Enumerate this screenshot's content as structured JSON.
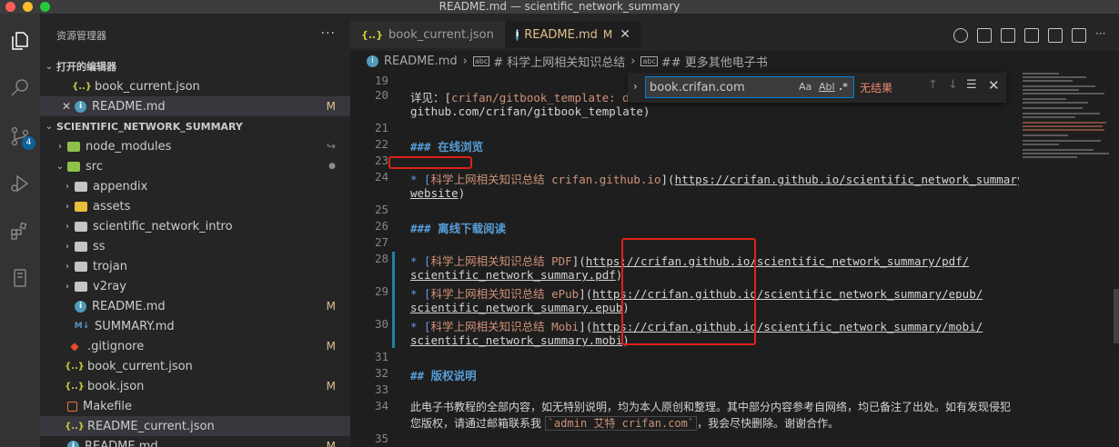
{
  "window": {
    "title": "README.md — scientific_network_summary"
  },
  "activity_bar": {
    "scm_badge": "4"
  },
  "sidebar": {
    "header": "资源管理器",
    "more": "···",
    "open_editors_title": "打开的编辑器",
    "open_editors": [
      {
        "name": "book_current.json",
        "icon": "{..}",
        "decoration": ""
      },
      {
        "name": "README.md",
        "icon": "i",
        "decoration": "M"
      }
    ],
    "project_title": "SCIENTIFIC_NETWORK_SUMMARY",
    "tree": [
      {
        "name": "node_modules",
        "decoration": "↪"
      },
      {
        "name": "src",
        "decoration": "●"
      },
      {
        "name": "appendix",
        "decoration": ""
      },
      {
        "name": "assets",
        "decoration": ""
      },
      {
        "name": "scientific_network_intro",
        "decoration": ""
      },
      {
        "name": "ss",
        "decoration": ""
      },
      {
        "name": "trojan",
        "decoration": ""
      },
      {
        "name": "v2ray",
        "decoration": ""
      },
      {
        "name": "README.md",
        "decoration": "M"
      },
      {
        "name": "SUMMARY.md",
        "decoration": ""
      },
      {
        "name": ".gitignore",
        "decoration": "M"
      },
      {
        "name": "book_current.json",
        "decoration": ""
      },
      {
        "name": "book.json",
        "decoration": "M"
      },
      {
        "name": "Makefile",
        "decoration": ""
      },
      {
        "name": "README_current.json",
        "decoration": ""
      },
      {
        "name": "README.md",
        "decoration": "M"
      }
    ]
  },
  "tabs": [
    {
      "label": "book_current.json",
      "icon": "{..}",
      "modified": ""
    },
    {
      "label": "README.md",
      "icon": "i",
      "modified": "M",
      "close": "✕"
    }
  ],
  "breadcrumb": {
    "file": "README.md",
    "h1": "# 科学上网相关知识总结",
    "h2": "## 更多其他电子书",
    "sep": "›"
  },
  "find": {
    "value": "book.crifan.com",
    "opt_case": "Aa",
    "opt_word": "Abl",
    "opt_regex": ".*",
    "result": "无结果",
    "prev": "↑",
    "next": "↓",
    "selection": "☰",
    "close": "✕"
  },
  "editor": {
    "line_numbers": [
      "19",
      "20",
      "21",
      "22",
      "23",
      "24",
      "25",
      "26",
      "27",
      "28",
      "29",
      "30",
      "31",
      "32",
      "33",
      "34",
      "35"
    ],
    "l20a_pre": "详见：[",
    "l20a_text": "crifan/gitbook_template: de",
    "l20b": "github.com/crifan/gitbook_template)",
    "l22": "### 在线浏览",
    "l24a_bullet": "* [",
    "l24a_text": "科学上网相关知识总结 crifan.github.io",
    "l24a_mid": "](",
    "l24a_url": "https://crifan.github.io/scientific_network_summary/",
    "l24b_url": "website",
    "l24b_end": ")",
    "l26": "### 离线下载阅读",
    "l28a_text": "科学上网相关知识总结 PDF",
    "l28a_url": "https://crifan.github.io/scientific_network_summary/pdf/",
    "l28b_url": "scientific_network_summary.pdf",
    "l29a_text": "科学上网相关知识总结 ePub",
    "l29a_url": "https://crifan.github.io/scientific_network_summary/epub/",
    "l29b_url": "scientific_network_summary.epub",
    "l30a_text": "科学上网相关知识总结 Mobi",
    "l30a_url": "https://crifan.github.io/scientific_network_summary/mobi/",
    "l30b_url": "scientific_network_summary.mobi",
    "l32": "## 版权说明",
    "l34a": "此电子书教程的全部内容，如无特别说明，均为本人原创和整理。其中部分内容参考自网络，均已备注了出处。如有发现侵犯",
    "l34b_pre": "您版权，请通过邮箱联系我 ",
    "l34b_code": "`admin 艾特 crifan.com`",
    "l34b_post": "，我会尽快删除。谢谢合作。"
  },
  "colors": {
    "accent": "#007fd4",
    "modified": "#e2c08d",
    "annotation": "#e0201a"
  }
}
